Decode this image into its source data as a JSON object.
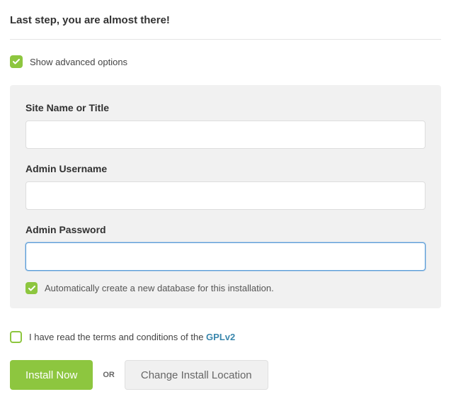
{
  "heading": "Last step, you are almost there!",
  "show_advanced": {
    "label": "Show advanced options",
    "checked": true
  },
  "fields": {
    "site_name": {
      "label": "Site Name or Title",
      "value": ""
    },
    "admin_username": {
      "label": "Admin Username",
      "value": ""
    },
    "admin_password": {
      "label": "Admin Password",
      "value": ""
    }
  },
  "auto_db": {
    "label": "Automatically create a new database for this installation.",
    "checked": true
  },
  "terms": {
    "prefix": "I have read the terms and conditions of the ",
    "link_text": "GPLv2",
    "checked": false
  },
  "actions": {
    "install": "Install Now",
    "or": "OR",
    "change_location": "Change Install Location"
  }
}
